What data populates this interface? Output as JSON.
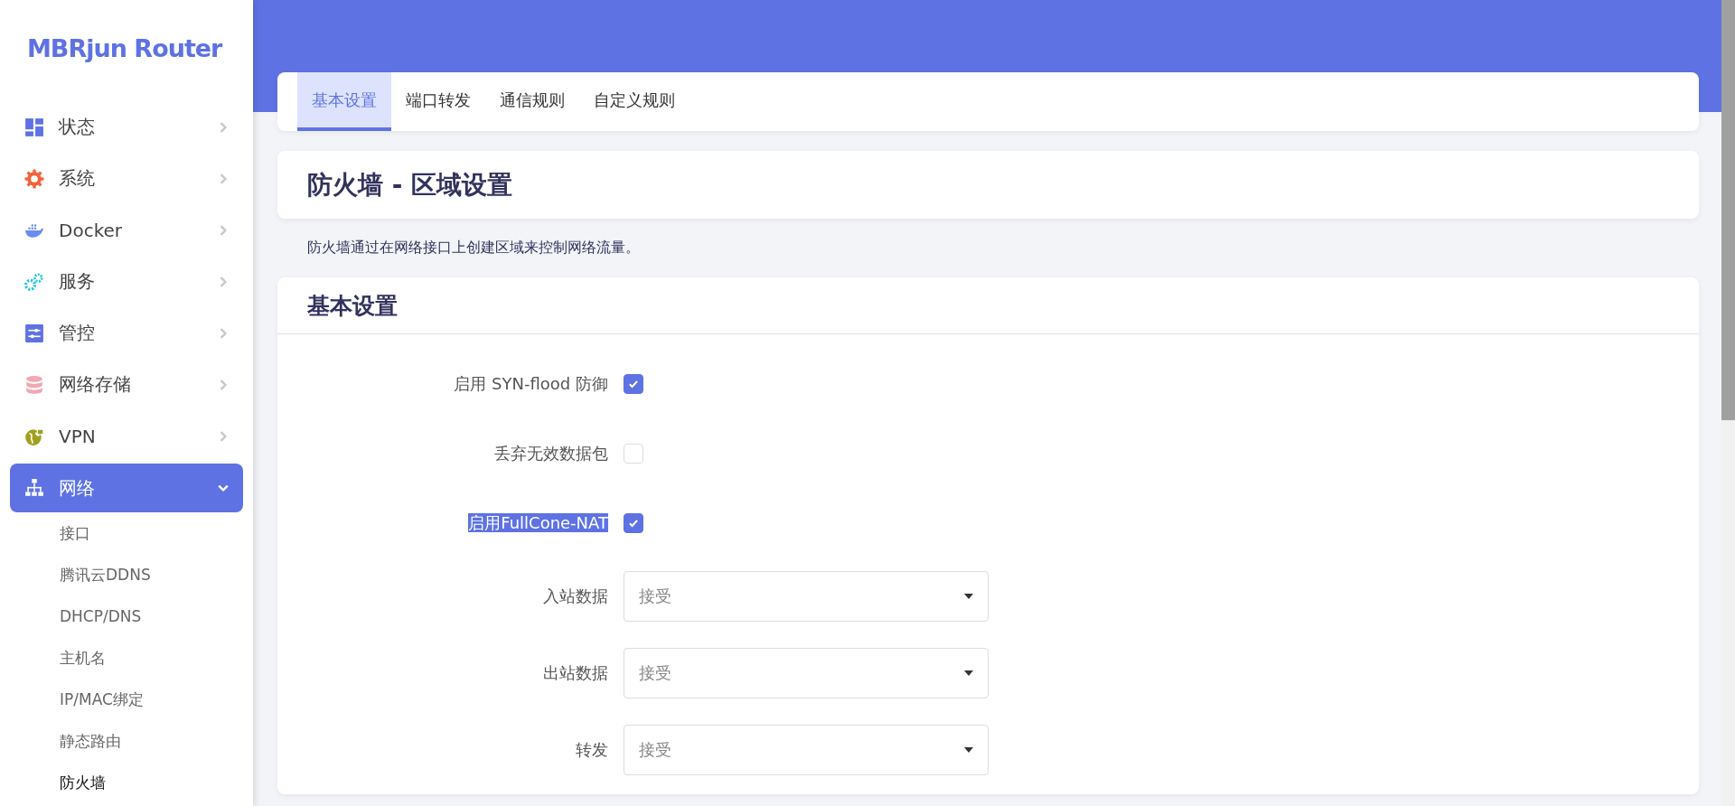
{
  "sidebar": {
    "logo": "MBRjun Router",
    "items": [
      {
        "label": "状态",
        "expanded": false,
        "selected": false
      },
      {
        "label": "系统",
        "expanded": false,
        "selected": false
      },
      {
        "label": "Docker",
        "expanded": false,
        "selected": false
      },
      {
        "label": "服务",
        "expanded": false,
        "selected": false
      },
      {
        "label": "管控",
        "expanded": false,
        "selected": false
      },
      {
        "label": "网络存储",
        "expanded": false,
        "selected": false
      },
      {
        "label": "VPN",
        "expanded": false,
        "selected": false
      },
      {
        "label": "网络",
        "expanded": true,
        "selected": true,
        "children": [
          {
            "label": "接口",
            "selected": false
          },
          {
            "label": "腾讯云DDNS",
            "selected": false
          },
          {
            "label": "DHCP/DNS",
            "selected": false
          },
          {
            "label": "主机名",
            "selected": false
          },
          {
            "label": "IP/MAC绑定",
            "selected": false
          },
          {
            "label": "静态路由",
            "selected": false
          },
          {
            "label": "防火墙",
            "selected": true
          }
        ]
      }
    ]
  },
  "tabs": [
    {
      "label": "基本设置",
      "selected": true
    },
    {
      "label": "端口转发",
      "selected": false
    },
    {
      "label": "通信规则",
      "selected": false
    },
    {
      "label": "自定义规则",
      "selected": false
    }
  ],
  "page_title": "防火墙 - 区域设置",
  "description": "防火墙通过在网络接口上创建区域来控制网络流量。",
  "section": {
    "title": "基本设置",
    "rows": [
      {
        "kind": "checkbox",
        "label": "启用 SYN-flood 防御",
        "checked": true,
        "text_selected": false
      },
      {
        "kind": "checkbox",
        "label": "丢弃无效数据包",
        "checked": false,
        "text_selected": false
      },
      {
        "kind": "checkbox",
        "label": "启用FullCone-NAT",
        "checked": true,
        "text_selected": true
      },
      {
        "kind": "select",
        "label": "入站数据",
        "value": "接受"
      },
      {
        "kind": "select",
        "label": "出站数据",
        "value": "接受"
      },
      {
        "kind": "select",
        "label": "转发",
        "value": "接受"
      }
    ]
  }
}
